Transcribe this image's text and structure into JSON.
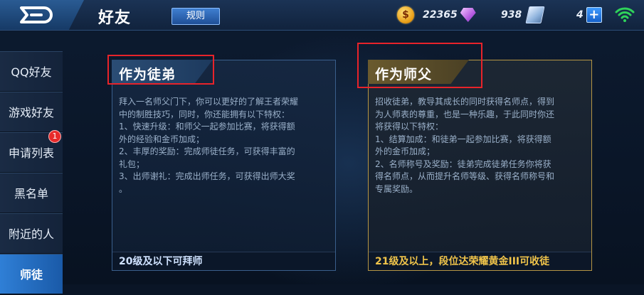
{
  "header": {
    "title": "好友",
    "rules_label": "规则",
    "gold": "22365",
    "diamonds": "938",
    "tickets": "4",
    "plus_symbol": "+"
  },
  "sidebar": {
    "items": [
      {
        "label": "QQ好友"
      },
      {
        "label": "游戏好友"
      },
      {
        "label": "申请列表",
        "badge": "1"
      },
      {
        "label": "黑名单"
      },
      {
        "label": "附近的人"
      },
      {
        "label": "师徒"
      }
    ]
  },
  "apprentice_card": {
    "title": "作为徒弟",
    "lines": [
      "拜入一名师父门下，你可以更好的了解王者荣耀",
      "中的制胜技巧，同时，你还能拥有以下特权：",
      "1、快速升级：和师父一起参加比赛，将获得额",
      "外的经验和金币加成；",
      "2、丰厚的奖励：完成师徒任务，可获得丰富的",
      "礼包；",
      "3、出师谢礼：完成出师任务，可获得出师大奖",
      "。"
    ],
    "footer": "20级及以下可拜师"
  },
  "master_card": {
    "title": "作为师父",
    "lines": [
      "招收徒弟，教导其成长的同时获得名师点，得到",
      "为人师表的尊重，也是一种乐趣，于此同时你还",
      "将获得以下特权：",
      "1、结算加成：和徒弟一起参加比赛，将获得额",
      "外的金币加成；",
      "2、名师称号及奖励：徒弟完成徒弟任务你将获",
      "得名师点，从而提升名师等级、获得名师称号和",
      "专属奖励。"
    ],
    "footer": "21级及以上，段位达荣耀黄金III可收徒"
  },
  "colors": {
    "highlight_box": "#e8232a",
    "active_tab": "#2f7fd6",
    "master_accent": "#f0c44a",
    "wifi": "#2fd35a"
  },
  "icons": [
    "back-icon",
    "gold-coin-icon",
    "diamond-icon",
    "ticket-icon",
    "plus-icon",
    "wifi-icon"
  ]
}
